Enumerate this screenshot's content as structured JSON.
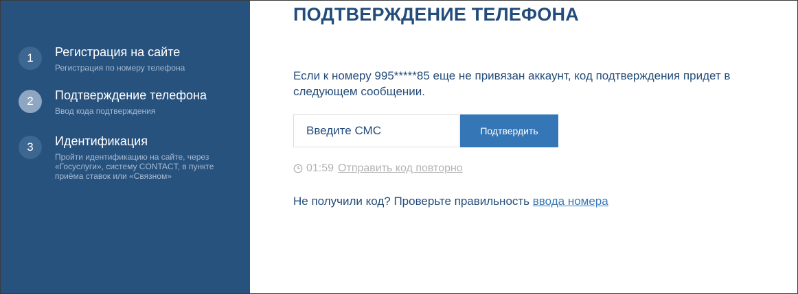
{
  "sidebar": {
    "steps": [
      {
        "number": "1",
        "title": "Регистрация на сайте",
        "description": "Регистрация по номеру телефона"
      },
      {
        "number": "2",
        "title": "Подтверждение телефона",
        "description": "Ввод кода подтверждения"
      },
      {
        "number": "3",
        "title": "Идентификация",
        "description": "Пройти идентификацию на сайте, через «Госуслуги», систему CONTACT, в пункте приёма ставок или «Связном»"
      }
    ],
    "active_step": "2"
  },
  "main": {
    "title": "Подтверждение телефона",
    "info_text": "Если к номеру 995*****85 еще не привязан аккаунт, код подтверждения придет в следующем сообщении.",
    "sms_input": {
      "placeholder": "Введите СМС",
      "value": ""
    },
    "confirm_button": "Подтвердить",
    "timer": {
      "icon": "clock-icon",
      "value": "01:59",
      "resend_label": "Отправить код повторно"
    },
    "help": {
      "text": "Не получили код? Проверьте правильность",
      "link": "ввода номера"
    }
  },
  "colors": {
    "sidebar_bg": "#27527e",
    "primary_text": "#234c7a",
    "button_bg": "#3577b6",
    "muted_text": "#b3b3b3"
  }
}
